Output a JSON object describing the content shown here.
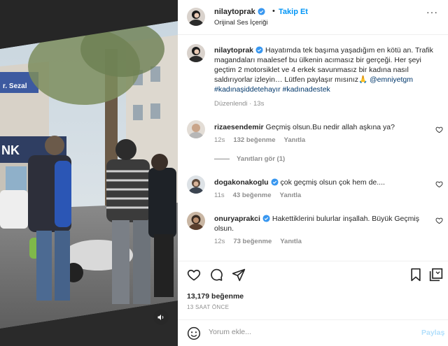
{
  "post": {
    "username": "nilaytoprak",
    "follow_label": "Takip Et",
    "dot": "•",
    "audio": "Orijinal Ses İçeriği"
  },
  "video": {
    "sign_fragment_1": "r. Sezal",
    "sign_fragment_2": "NK"
  },
  "caption": {
    "username": "nilaytoprak",
    "text": "Hayatımda tek başıma yaşadığım en kötü an. Trafik magandaları maalesef bu ülkenin acımasız bir gerçeği. Her şeyi geçtim 2 motorsiklet ve 4 erkek savunmasız bir kadına nasıl saldırıyorlar izleyin… Lütfen paylaşır mısınız🙏",
    "tags": "@emniyetgm #kadınaşiddetehayır #kadınadestek",
    "edited": "Düzenlendi",
    "time": "13s"
  },
  "comments": [
    {
      "username": "rizaesendemir",
      "text": "Geçmiş olsun.Bu nedir allah aşkına ya?",
      "time": "12s",
      "likes": "132 beğenme",
      "reply": "Yanıtla",
      "replies": "Yanıtları gör (1)"
    },
    {
      "username": "dogakonakoglu",
      "text": "çok geçmiş olsun çok hem de....",
      "time": "11s",
      "likes": "43 beğenme",
      "reply": "Yanıtla"
    },
    {
      "username": "onuryaprakci",
      "text": "Hakettiklerini bulurlar inşallah. Büyük Geçmiş olsun.",
      "time": "12s",
      "likes": "73 beğenme",
      "reply": "Yanıtla"
    }
  ],
  "footer": {
    "likes": "13,179 beğenme",
    "time_ago": "13 SAAT ÖNCE",
    "comment_placeholder": "Yorum ekle...",
    "share_label": "Paylaş"
  },
  "icons": {
    "verified": "verified-badge-icon",
    "like": "heart-icon",
    "comment": "comment-icon",
    "share": "paper-plane-icon",
    "save": "bookmark-icon",
    "emoji": "smiley-icon",
    "mute": "speaker-icon",
    "more": "more-dots-icon"
  },
  "colors": {
    "accent": "#0095f6",
    "verified": "#3897f0",
    "muted_text": "#8e8e8e",
    "hashtag": "#00376b"
  }
}
